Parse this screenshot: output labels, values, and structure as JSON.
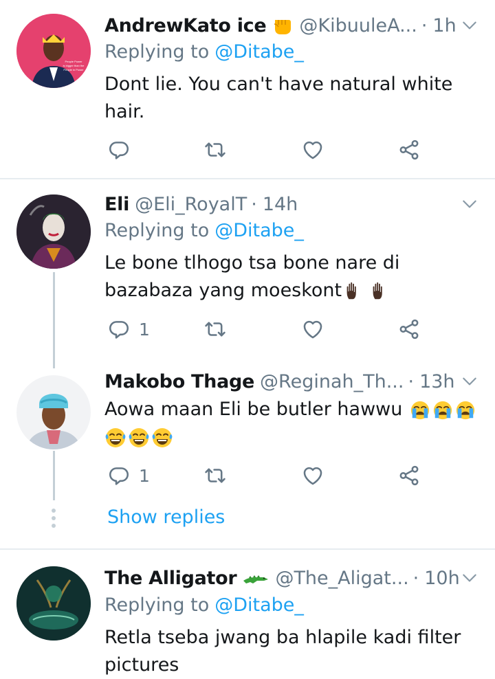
{
  "tweets": [
    {
      "name": "AndrewKato ice",
      "name_emoji": "fist-emoji",
      "handle": "@KibuuleA...",
      "dot": "·",
      "time": "1h",
      "replying_label": "Replying to",
      "replying_to": "@Ditabe_",
      "text_lines": [
        "Dont lie. You can't have natural white",
        "hair."
      ],
      "reply_count": "",
      "avatar_caption": [
        "People Power",
        "is bigger than the",
        "People in Power"
      ]
    },
    {
      "name": "Eli",
      "handle": "@Eli_RoyalT",
      "dot": "·",
      "time": "14h",
      "replying_label": "Replying to",
      "replying_to": "@Ditabe_",
      "text_lines": [
        "Le bone tlhogo tsa bone nare di",
        "bazabaza yang moeskont"
      ],
      "text_emojis": [
        "raised-hand-dark-emoji",
        "raised-hand-dark-emoji"
      ],
      "reply_count": "1"
    },
    {
      "name": "Makobo Thage",
      "handle": "@Reginah_Th...",
      "dot": "·",
      "time": "13h",
      "text_lines": [
        "Aowa maan Eli be butler hawwu"
      ],
      "text_emojis": [
        "crying-face-emoji",
        "crying-face-emoji",
        "crying-face-emoji"
      ],
      "second_line_emojis": [
        "tears-of-joy-emoji",
        "tears-of-joy-emoji",
        "tears-of-joy-emoji"
      ],
      "reply_count": "1"
    },
    {
      "name": "The Alligator",
      "name_emoji": "crocodile-emoji",
      "handle": "@The_Aligat...",
      "dot": "·",
      "time": "10h",
      "replying_label": "Replying to",
      "replying_to": "@Ditabe_",
      "text_lines": [
        "Retla tseba jwang ba hlapile kadi filter",
        "pictures"
      ]
    }
  ],
  "show_replies": "Show replies",
  "icons": {
    "reply": "reply-icon",
    "retweet": "retweet-icon",
    "like": "heart-icon",
    "share": "share-icon",
    "menu": "chevron-down-icon"
  },
  "colors": {
    "link": "#1da1f2",
    "secondary_text": "#657786",
    "divider": "#e6ecf0"
  }
}
